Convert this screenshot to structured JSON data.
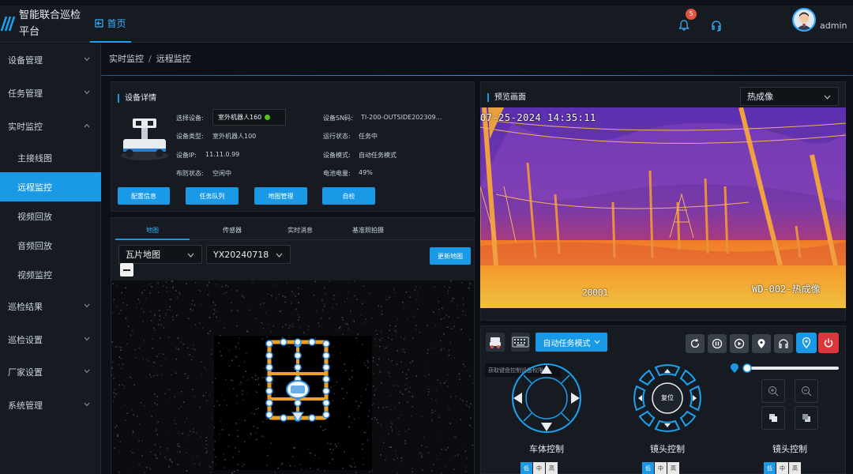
{
  "header": {
    "title": "智能联合巡检平台",
    "home_tab": "首页",
    "notification_count": "5",
    "username": "admin"
  },
  "sidebar": {
    "items": [
      {
        "label": "设备管理"
      },
      {
        "label": "任务管理"
      },
      {
        "label": "实时监控"
      },
      {
        "label": "主接线图"
      },
      {
        "label": "远程监控"
      },
      {
        "label": "视频回放"
      },
      {
        "label": "音频回放"
      },
      {
        "label": "视频监控"
      },
      {
        "label": "巡检结果"
      },
      {
        "label": "巡检设置"
      },
      {
        "label": "厂家设置"
      },
      {
        "label": "系统管理"
      }
    ]
  },
  "breadcrumb": {
    "parent": "实时监控",
    "separator": "/",
    "current": "远程监控"
  },
  "device_panel": {
    "title": "设备详情",
    "select_label": "选择设备:",
    "select_value": "室外机器人160",
    "type_label": "设备类型:",
    "type_value": "室外机器人100",
    "ip_label": "设备IP:",
    "ip_value": "11.11.0.99",
    "guard_label": "布防状态:",
    "guard_value": "空闲中",
    "sn_label": "设备SN码:",
    "sn_value": "TI-200-OUTSIDE202309...",
    "run_label": "运行状态:",
    "run_value": "任务中",
    "mode_label": "设备模式:",
    "mode_value": "自动任务模式",
    "battery_label": "电池电量:",
    "battery_value": "49%",
    "buttons": [
      "配置信息",
      "任务队列",
      "地图管理",
      "自检"
    ]
  },
  "map_panel": {
    "tabs": [
      "地图",
      "传感器",
      "实时消息",
      "基准照拍摄"
    ],
    "map_type": "瓦片地图",
    "map_version": "YX20240718",
    "update_button": "更新地图"
  },
  "preview": {
    "title": "预览画面",
    "stream_select": "热成像",
    "osd_time": "07-25-2024 14:35:11",
    "osd_camera": "WD-002-热成像",
    "osd_number": "20001"
  },
  "control": {
    "mode_select": "自动任务模式",
    "tooltip": "获取键盘控制设备权限",
    "reset_label": "复位",
    "body_label": "车体控制",
    "lens_label": "镜头控制",
    "lens2_label": "镜头控制",
    "speeds": [
      "低",
      "中",
      "高"
    ],
    "slider_value": 0.03
  },
  "colors": {
    "accent": "#1a9ae6",
    "danger": "#e5533d",
    "online": "#52c41a"
  }
}
